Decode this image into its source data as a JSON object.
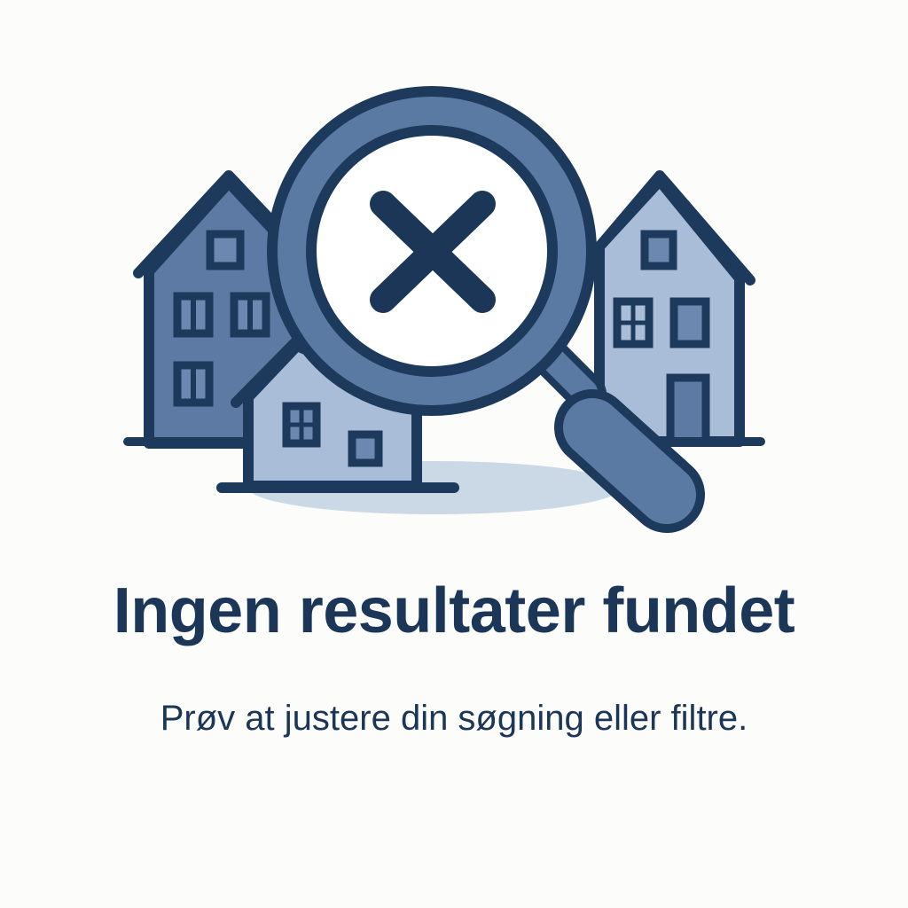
{
  "empty_state": {
    "title": "Ingen resultater fundet",
    "subtitle": "Prøv at justere din søgning eller filtre."
  },
  "illustration": {
    "icons": [
      "house-icon",
      "magnifying-glass-icon",
      "no-results-x-icon"
    ]
  },
  "colors": {
    "text_dark": "#1b3656",
    "outline": "#1d3a5c",
    "house_dark": "#5c7aa3",
    "house_light": "#a9bdd8",
    "window_fill": "#6d88b0",
    "lens_ring": "#5a7aa4",
    "lens_glass": "#ffffff",
    "shadow": "#cbd8e6",
    "background": "#fcfcfb"
  }
}
